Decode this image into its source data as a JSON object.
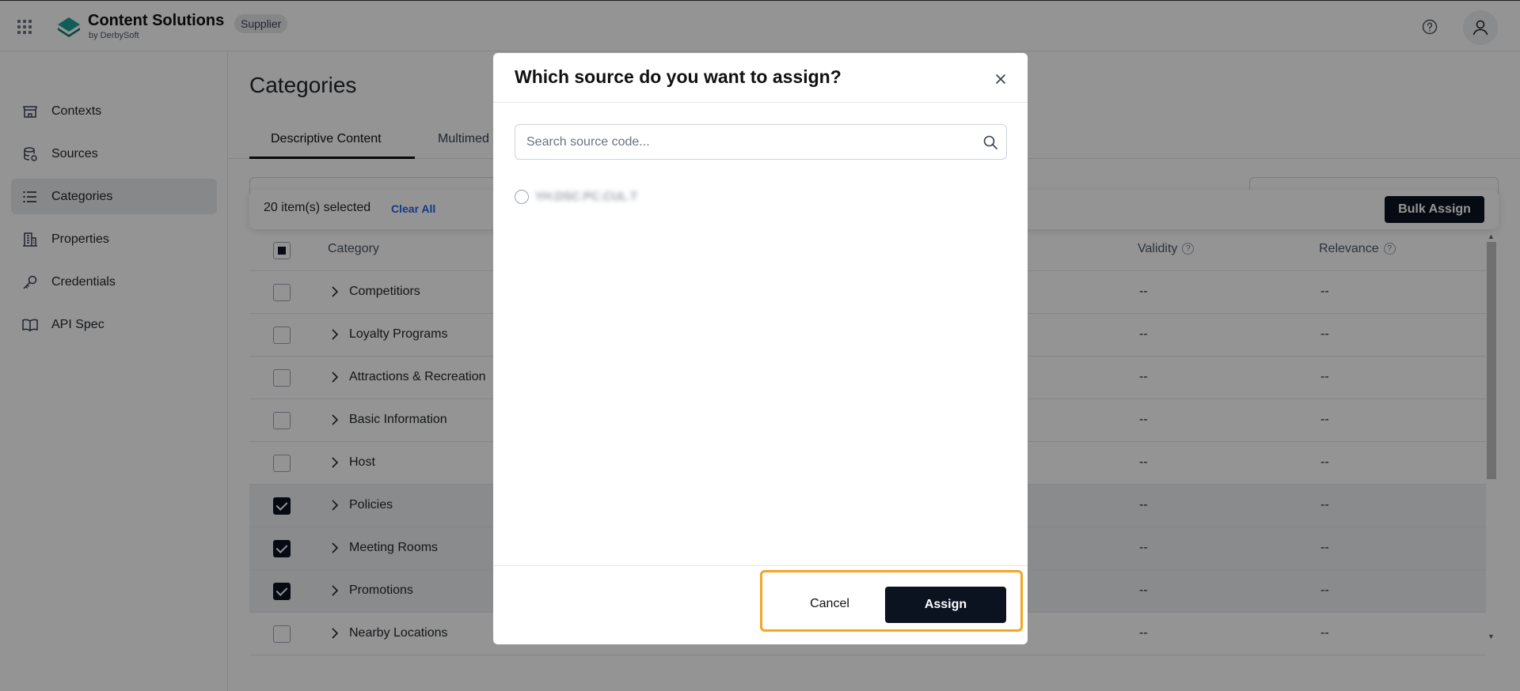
{
  "header": {
    "brand_title": "Content Solutions",
    "brand_subtitle": "by DerbySoft",
    "badge": "Supplier"
  },
  "sidebar": {
    "items": [
      {
        "label": "Contexts",
        "icon": "store-icon"
      },
      {
        "label": "Sources",
        "icon": "database-icon"
      },
      {
        "label": "Categories",
        "icon": "list-icon",
        "active": true
      },
      {
        "label": "Properties",
        "icon": "building-icon"
      },
      {
        "label": "Credentials",
        "icon": "key-icon"
      },
      {
        "label": "API Spec",
        "icon": "book-icon"
      }
    ]
  },
  "main": {
    "title": "Categories",
    "tabs": [
      {
        "label": "Descriptive Content",
        "active": true
      },
      {
        "label": "Multimed"
      }
    ],
    "bulk_bar": {
      "selected_text": "20 item(s) selected",
      "clear_all": "Clear All",
      "bulk_assign": "Bulk Assign"
    },
    "table": {
      "columns": {
        "category": "Category",
        "validity": "Validity",
        "relevance": "Relevance"
      },
      "rows": [
        {
          "name": "Competitiors",
          "validity": "--",
          "relevance": "--",
          "checked": false
        },
        {
          "name": "Loyalty Programs",
          "validity": "--",
          "relevance": "--",
          "checked": false
        },
        {
          "name": "Attractions & Recreation",
          "validity": "--",
          "relevance": "--",
          "checked": false
        },
        {
          "name": "Basic Information",
          "validity": "--",
          "relevance": "--",
          "checked": false
        },
        {
          "name": "Host",
          "validity": "--",
          "relevance": "--",
          "checked": false
        },
        {
          "name": "Policies",
          "validity": "--",
          "relevance": "--",
          "checked": true
        },
        {
          "name": "Meeting Rooms",
          "validity": "--",
          "relevance": "--",
          "checked": true
        },
        {
          "name": "Promotions",
          "validity": "--",
          "relevance": "--",
          "checked": true
        },
        {
          "name": "Nearby Locations",
          "validity": "--",
          "relevance": "--",
          "checked": false
        }
      ]
    }
  },
  "modal": {
    "title": "Which source do you want to assign?",
    "search_placeholder": "Search source code...",
    "search_value": "",
    "option_label": "YH.DSC.PC.CUL.T",
    "cancel": "Cancel",
    "assign": "Assign"
  },
  "colors": {
    "primary": "#0b1220",
    "link": "#2563eb",
    "highlight": "#f5a623",
    "brand_teal": "#1aa39a"
  }
}
